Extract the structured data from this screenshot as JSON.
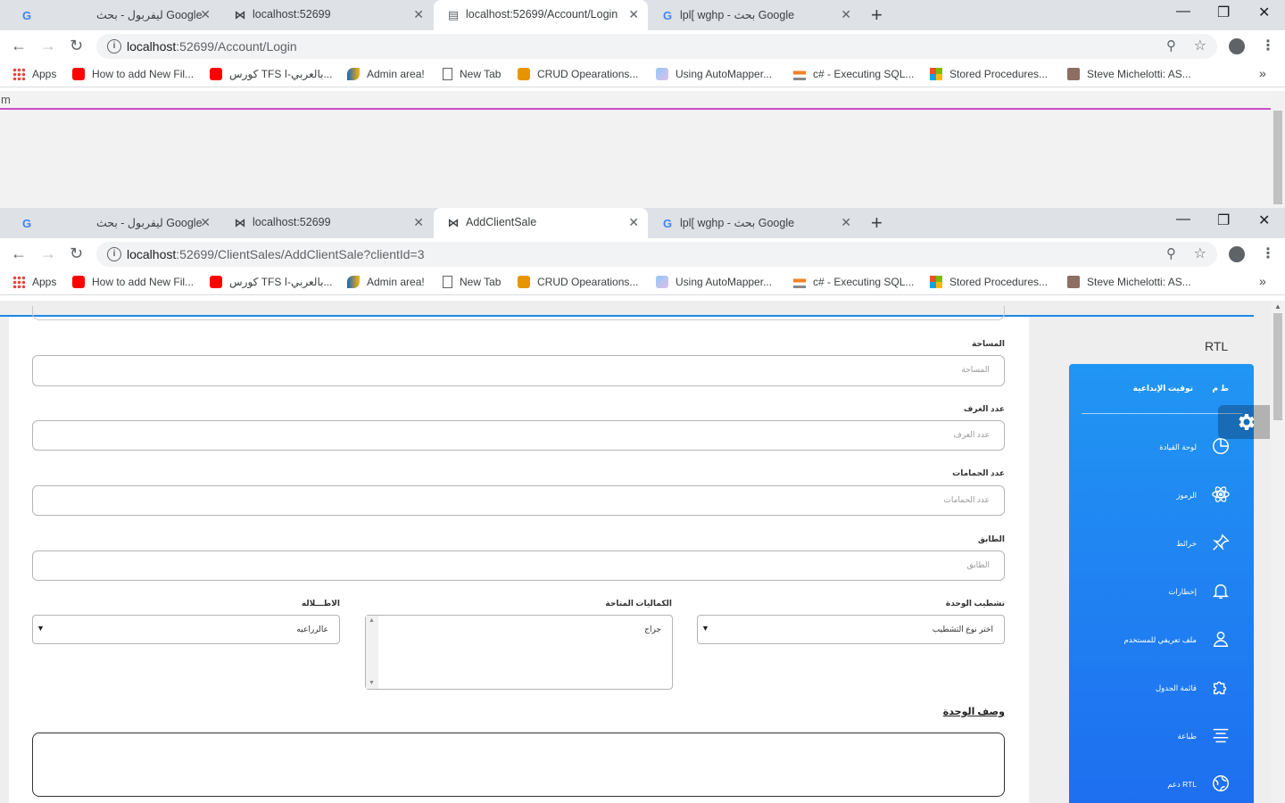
{
  "window1": {
    "tabs": [
      {
        "title": "ليفربول - بحث Google",
        "favicon": "google-icon"
      },
      {
        "title": "localhost:52699",
        "favicon": "bowtie-icon"
      },
      {
        "title": "localhost:52699/Account/Login",
        "favicon": "page-icon"
      },
      {
        "title": "lpl[ wghp - بحث Google",
        "favicon": "google-icon"
      }
    ],
    "url_host": "localhost",
    "url_rest": ":52699/Account/Login",
    "content_text": "m"
  },
  "window2": {
    "tabs": [
      {
        "title": "ليفربول - بحث Google",
        "favicon": "google-icon"
      },
      {
        "title": "localhost:52699",
        "favicon": "bowtie-icon"
      },
      {
        "title": "AddClientSale",
        "favicon": "bowtie-icon"
      },
      {
        "title": "lpl[ wghp - بحث Google",
        "favicon": "google-icon"
      }
    ],
    "url_host": "localhost",
    "url_rest": ":52699/ClientSales/AddClientSale?clientId=3"
  },
  "bookmarks": [
    {
      "label": "Apps",
      "icon": "apps-grid-icon"
    },
    {
      "label": "How to add New Fil...",
      "icon": "youtube-icon"
    },
    {
      "label": "كورس TFS بالعربي-ا...",
      "icon": "youtube-icon"
    },
    {
      "label": "Admin area!",
      "icon": "bird-icon"
    },
    {
      "label": "New Tab",
      "icon": "page-icon"
    },
    {
      "label": "CRUD Opearations...",
      "icon": "code-icon"
    },
    {
      "label": "Using AutoMapper...",
      "icon": "automapper-icon"
    },
    {
      "label": "c# - Executing SQL...",
      "icon": "stackoverflow-icon"
    },
    {
      "label": "Stored Procedures...",
      "icon": "microsoft-icon"
    },
    {
      "label": "Steve Michelotti: AS...",
      "icon": "avatar-icon"
    }
  ],
  "form": {
    "area_label": "المساحة",
    "area_placeholder": "المساحة",
    "rooms_label": "عدد الغرف",
    "rooms_placeholder": "عدد الغرف",
    "baths_label": "عدد الحمامات",
    "baths_placeholder": "عدد الحمامات",
    "floor_label": "الطابق",
    "floor_placeholder": "الطابق",
    "finish_label": "تشطيب الوحدة",
    "finish_value": "اختر نوع التشطيب",
    "extras_label": "الكماليات المتاحة",
    "extras_value": "جراج",
    "view_label": "الاطـــلاله",
    "view_value": "عالرراعيه",
    "description_label": "وصف الوحدة"
  },
  "rtl_label": "RTL",
  "sidebar": {
    "logo": "ط م",
    "brand": "توقيت الإبداعية",
    "items": [
      {
        "label": "لوحة القيادة",
        "icon": "pie-chart-icon"
      },
      {
        "label": "الرموز",
        "icon": "atom-icon"
      },
      {
        "label": "خرائط",
        "icon": "pin-icon"
      },
      {
        "label": "إخطارات",
        "icon": "bell-icon"
      },
      {
        "label": "ملف تعريفي للمستخدم",
        "icon": "user-icon"
      },
      {
        "label": "قائمة الجدول",
        "icon": "puzzle-icon"
      },
      {
        "label": "طباعة",
        "icon": "align-center-icon"
      },
      {
        "label": "دعم RTL",
        "icon": "world-icon"
      }
    ]
  },
  "colors": {
    "sidebar_top": "#2196f3",
    "sidebar_bottom": "#1e6ef0",
    "accent_line": "#1e88e5",
    "magenta_line": "#c94ec9"
  }
}
